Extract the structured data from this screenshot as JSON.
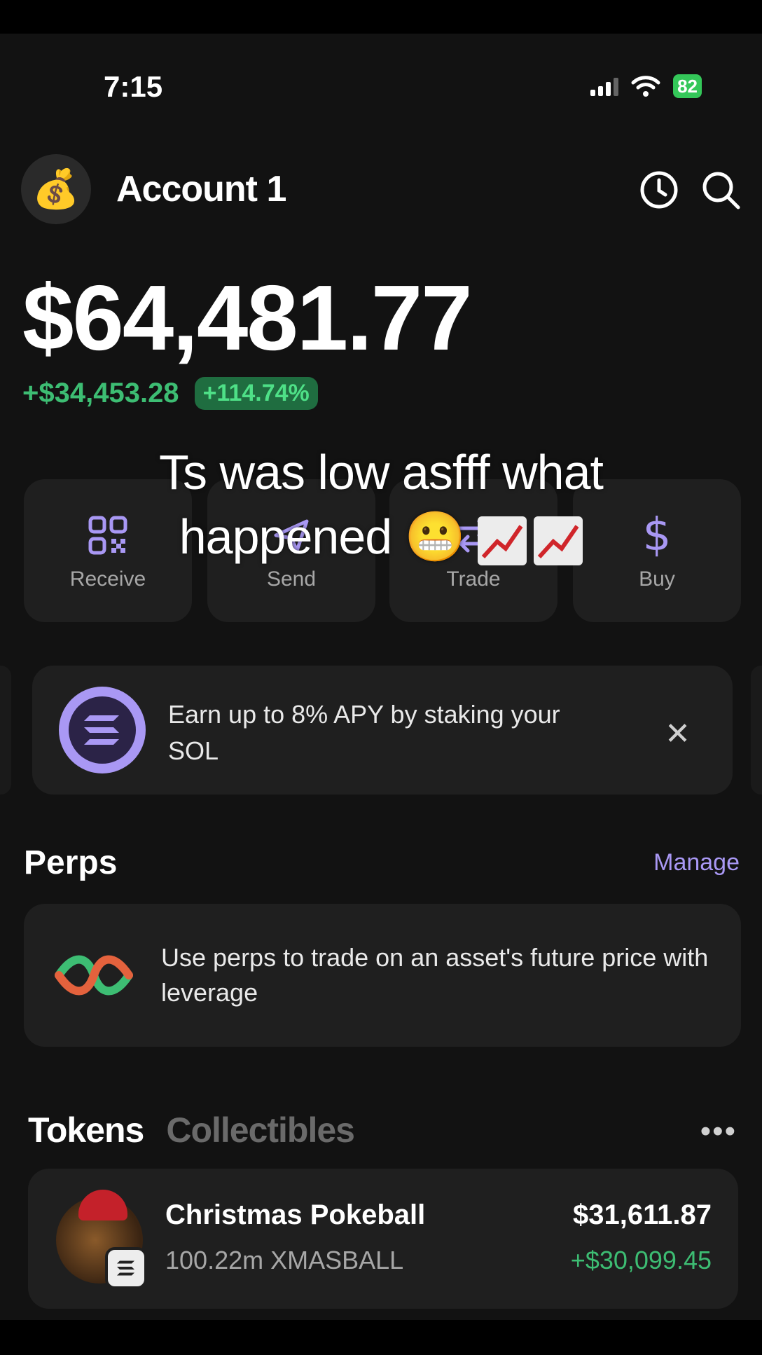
{
  "status": {
    "time": "7:15",
    "battery": "82"
  },
  "header": {
    "account_name": "Account 1",
    "avatar_emoji": "💰"
  },
  "balance": {
    "total": "$64,481.77",
    "change_amount": "+$34,453.28",
    "change_percent": "+114.74%"
  },
  "actions": [
    {
      "label": "Receive",
      "icon": "qr-code-icon"
    },
    {
      "label": "Send",
      "icon": "send-icon"
    },
    {
      "label": "Trade",
      "icon": "swap-icon"
    },
    {
      "label": "Buy",
      "icon": "dollar-icon"
    }
  ],
  "caption": {
    "line1": "Ts was low asfff what",
    "line2": "happened 😬"
  },
  "staking_banner": {
    "text": "Earn up to 8% APY by staking your SOL"
  },
  "perps": {
    "title": "Perps",
    "manage_label": "Manage",
    "description": "Use perps to trade on an asset's future price with leverage"
  },
  "tabs": {
    "active": "Tokens",
    "inactive": "Collectibles",
    "more": "•••"
  },
  "tokens": [
    {
      "name": "Christmas Pokeball",
      "amount": "100.22m XMASBALL",
      "value": "$31,611.87",
      "change": "+$30,099.45"
    }
  ],
  "colors": {
    "accent": "#a998f4",
    "positive": "#3dbd73",
    "background": "#121212",
    "card": "#1f1f1f"
  }
}
